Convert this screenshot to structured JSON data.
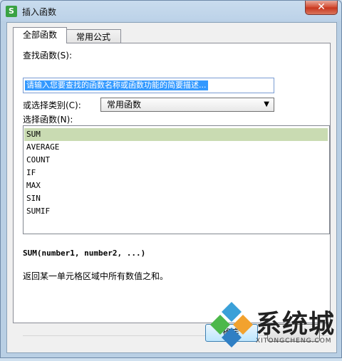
{
  "window": {
    "title": "插入函数",
    "app_icon_letter": "S",
    "close_glyph": "✕"
  },
  "tabs": [
    {
      "label": "全部函数"
    },
    {
      "label": "常用公式"
    }
  ],
  "search": {
    "label": "查找函数(S):",
    "value": "请输入您要查找的函数名称或函数功能的简要描述..."
  },
  "category": {
    "label": "或选择类别(C):",
    "value": "常用函数",
    "arrow": "▼"
  },
  "functions": {
    "label": "选择函数(N):",
    "items": [
      "SUM",
      "AVERAGE",
      "COUNT",
      "IF",
      "MAX",
      "SIN",
      "SUMIF"
    ],
    "selected": "SUM"
  },
  "syntax": "SUM(number1, number2, ...)",
  "description": "返回某一单元格区域中所有数值之和。",
  "buttons": {
    "ok": "确定"
  },
  "watermark": {
    "text": "系统城",
    "sub": "XITONGCHENG.COM"
  }
}
